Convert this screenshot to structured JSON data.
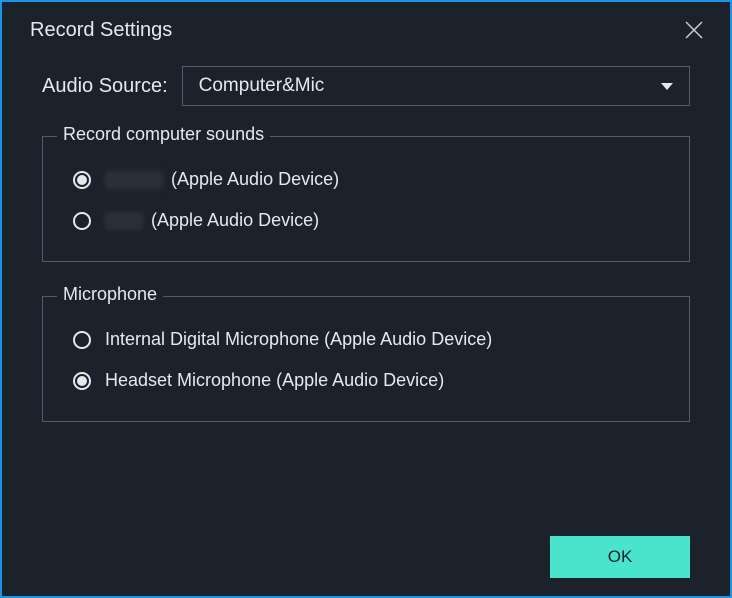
{
  "title": "Record Settings",
  "audio_source": {
    "label": "Audio Source:",
    "selected": "Computer&Mic"
  },
  "computer_sounds": {
    "legend": "Record computer sounds",
    "options": [
      {
        "label": "(Apple Audio Device)",
        "selected": true,
        "obscured_width": 58
      },
      {
        "label": "(Apple Audio Device)",
        "selected": false,
        "obscured_width": 38
      }
    ]
  },
  "microphone": {
    "legend": "Microphone",
    "options": [
      {
        "label": "Internal Digital Microphone (Apple Audio Device)",
        "selected": false
      },
      {
        "label": "Headset Microphone (Apple Audio Device)",
        "selected": true
      }
    ]
  },
  "buttons": {
    "ok": "OK"
  },
  "colors": {
    "accent": "#48e5cc",
    "background": "#1c222c",
    "border": "#555c68",
    "text": "#e6e8ec"
  }
}
